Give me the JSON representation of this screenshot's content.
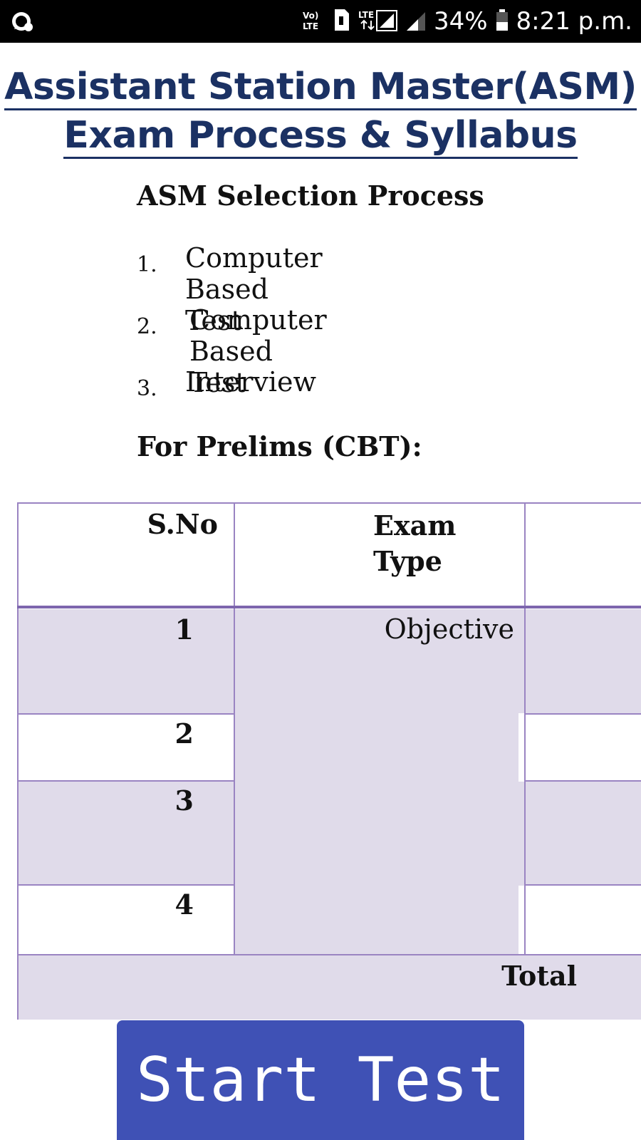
{
  "status_bar": {
    "left_icon": "whatsapp-icon",
    "volte_label": "Vo)\nLTE",
    "lte_label": "LTE",
    "battery_percent": "34%",
    "time": "8:21 p.m."
  },
  "title": {
    "line1": "Assistant Station Master(ASM)",
    "line2": "Exam Process & Syllabus"
  },
  "selection": {
    "heading": "ASM Selection Process",
    "items": [
      {
        "num": "1.",
        "label": "Computer Based Test"
      },
      {
        "num": "2.",
        "label": "Computer Based Test"
      },
      {
        "num": "3.",
        "label": "Interview"
      }
    ]
  },
  "prelims_heading": "For Prelims (CBT):",
  "table": {
    "headers": {
      "sno": "S.No",
      "exam_type": "Exam\nType"
    },
    "rows": [
      {
        "sno": "1"
      },
      {
        "sno": "2"
      },
      {
        "sno": "3"
      },
      {
        "sno": "4"
      }
    ],
    "exam_type_value": "Objective",
    "total_label": "Total"
  },
  "start_button": {
    "label": "Start Test"
  },
  "colors": {
    "title": "#1b3163",
    "table_border": "#9a84c2",
    "row_shade": "#e0dbea",
    "button": "#3f51b5"
  }
}
